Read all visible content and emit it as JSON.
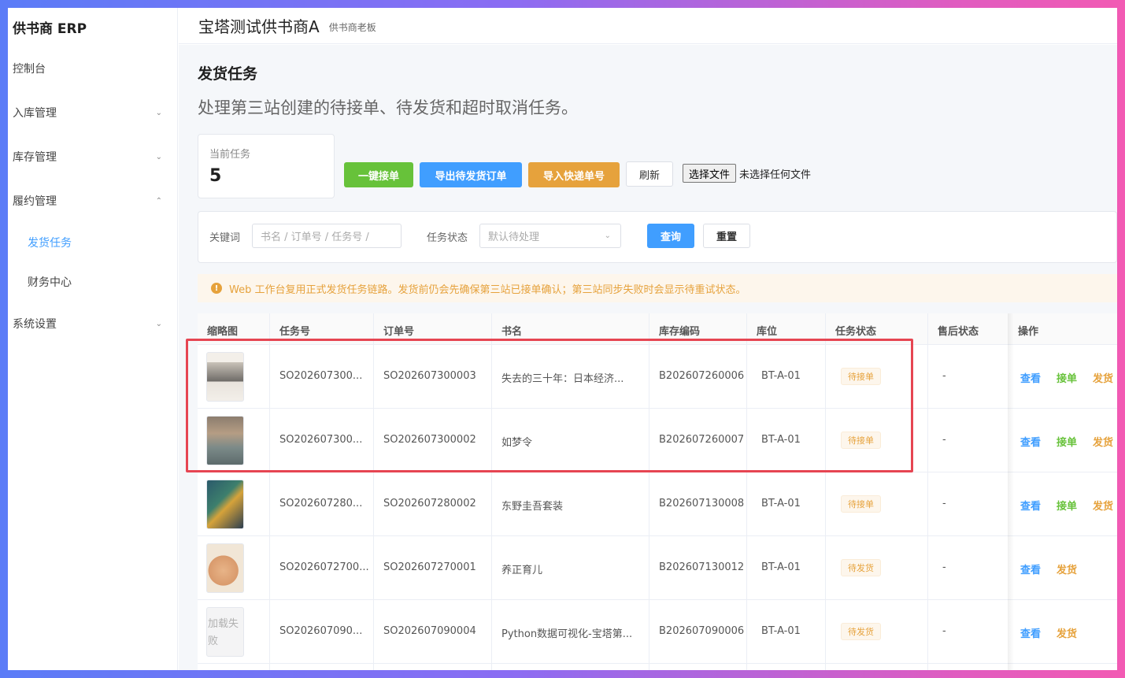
{
  "app": {
    "brand": "供书商 ERP"
  },
  "sidebar": {
    "items": [
      {
        "label": "控制台"
      },
      {
        "label": "入库管理"
      },
      {
        "label": "库存管理"
      },
      {
        "label": "履约管理"
      },
      {
        "label": "发货任务"
      },
      {
        "label": "财务中心"
      },
      {
        "label": "系统设置"
      }
    ]
  },
  "header": {
    "org_name": "宝塔测试供书商A",
    "role": "供书商老板"
  },
  "page": {
    "title": "发货任务",
    "description": "处理第三站创建的待接单、待发货和超时取消任务。"
  },
  "stat": {
    "label": "当前任务",
    "value": "5"
  },
  "toolbar": {
    "accept_all": "一键接单",
    "export": "导出待发货订单",
    "import": "导入快递单号",
    "refresh": "刷新",
    "choose_file": "选择文件",
    "file_status": "未选择任何文件"
  },
  "filter": {
    "keyword_label": "关键词",
    "keyword_placeholder": "书名 / 订单号 / 任务号 /",
    "status_label": "任务状态",
    "status_value": "默认待处理",
    "search": "查询",
    "reset": "重置"
  },
  "alert": {
    "text": "Web 工作台复用正式发货任务链路。发货前仍会先确保第三站已接单确认；第三站同步失败时会显示待重试状态。"
  },
  "table": {
    "columns": [
      "缩略图",
      "任务号",
      "订单号",
      "书名",
      "库存编码",
      "库位",
      "任务状态",
      "售后状态",
      "操作"
    ],
    "rows": [
      {
        "task_no": "SO202607300...",
        "order_no": "SO202607300003",
        "title": "失去的三十年：日本经济...",
        "sku": "B202607260006",
        "location": "BT-A-01",
        "status": "待接单",
        "after_sale": "-",
        "ops": [
          "查看",
          "接单",
          "发货"
        ]
      },
      {
        "task_no": "SO202607300...",
        "order_no": "SO202607300002",
        "title": "如梦令",
        "sku": "B202607260007",
        "location": "BT-A-01",
        "status": "待接单",
        "after_sale": "-",
        "ops": [
          "查看",
          "接单",
          "发货"
        ]
      },
      {
        "task_no": "SO202607280...",
        "order_no": "SO202607280002",
        "title": "东野圭吾套装",
        "sku": "B202607130008",
        "location": "BT-A-01",
        "status": "待接单",
        "after_sale": "-",
        "ops": [
          "查看",
          "接单",
          "发货"
        ]
      },
      {
        "task_no": "SO2026072700...",
        "order_no": "SO202607270001",
        "title": "养正育儿",
        "sku": "B202607130012",
        "location": "BT-A-01",
        "status": "待发货",
        "after_sale": "-",
        "ops": [
          "查看",
          "发货"
        ]
      },
      {
        "task_no": "SO202607090...",
        "order_no": "SO202607090004",
        "title": "Python数据可视化-宝塔第...",
        "sku": "B202607090006",
        "location": "BT-A-01",
        "status": "待发货",
        "after_sale": "-",
        "ops": [
          "查看",
          "发货"
        ]
      }
    ],
    "thumb_failed_text": "加载失败"
  },
  "colors": {
    "accent": "#409eff",
    "success": "#67c23a",
    "warning": "#e6a23c",
    "highlight": "#e64552"
  }
}
